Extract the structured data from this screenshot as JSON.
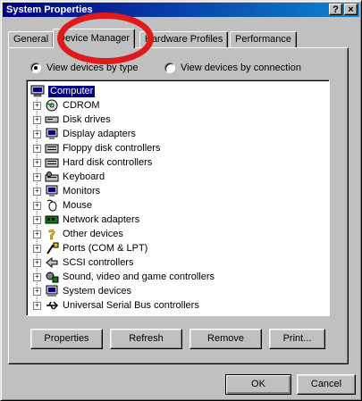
{
  "window": {
    "title": "System Properties",
    "help_label": "?",
    "close_label": "×"
  },
  "tabs": [
    {
      "label": "General",
      "active": false
    },
    {
      "label": "Device Manager",
      "active": true
    },
    {
      "label": "Hardware Profiles",
      "active": false
    },
    {
      "label": "Performance",
      "active": false
    }
  ],
  "view": {
    "by_type_label": "View devices by type",
    "by_connection_label": "View devices by connection",
    "selected": "by_type"
  },
  "tree": {
    "root": "Computer",
    "items": [
      {
        "label": "CDROM",
        "icon": "cdrom-icon"
      },
      {
        "label": "Disk drives",
        "icon": "disk-drive-icon"
      },
      {
        "label": "Display adapters",
        "icon": "display-adapter-icon"
      },
      {
        "label": "Floppy disk controllers",
        "icon": "floppy-controller-icon"
      },
      {
        "label": "Hard disk controllers",
        "icon": "hard-disk-controller-icon"
      },
      {
        "label": "Keyboard",
        "icon": "keyboard-icon"
      },
      {
        "label": "Monitors",
        "icon": "monitor-icon"
      },
      {
        "label": "Mouse",
        "icon": "mouse-icon"
      },
      {
        "label": "Network adapters",
        "icon": "network-adapter-icon"
      },
      {
        "label": "Other devices",
        "icon": "question-mark-icon"
      },
      {
        "label": "Ports (COM & LPT)",
        "icon": "port-icon"
      },
      {
        "label": "SCSI controllers",
        "icon": "scsi-icon"
      },
      {
        "label": "Sound, video and game controllers",
        "icon": "sound-icon"
      },
      {
        "label": "System devices",
        "icon": "system-device-icon"
      },
      {
        "label": "Universal Serial Bus controllers",
        "icon": "usb-icon"
      }
    ]
  },
  "actions": {
    "properties": "Properties",
    "refresh": "Refresh",
    "remove": "Remove",
    "print": "Print..."
  },
  "dialog": {
    "ok": "OK",
    "cancel": "Cancel"
  },
  "colors": {
    "title_start": "#000080",
    "title_end": "#1084d0",
    "face": "#c0c0c0",
    "annotation": "#e0191c"
  }
}
